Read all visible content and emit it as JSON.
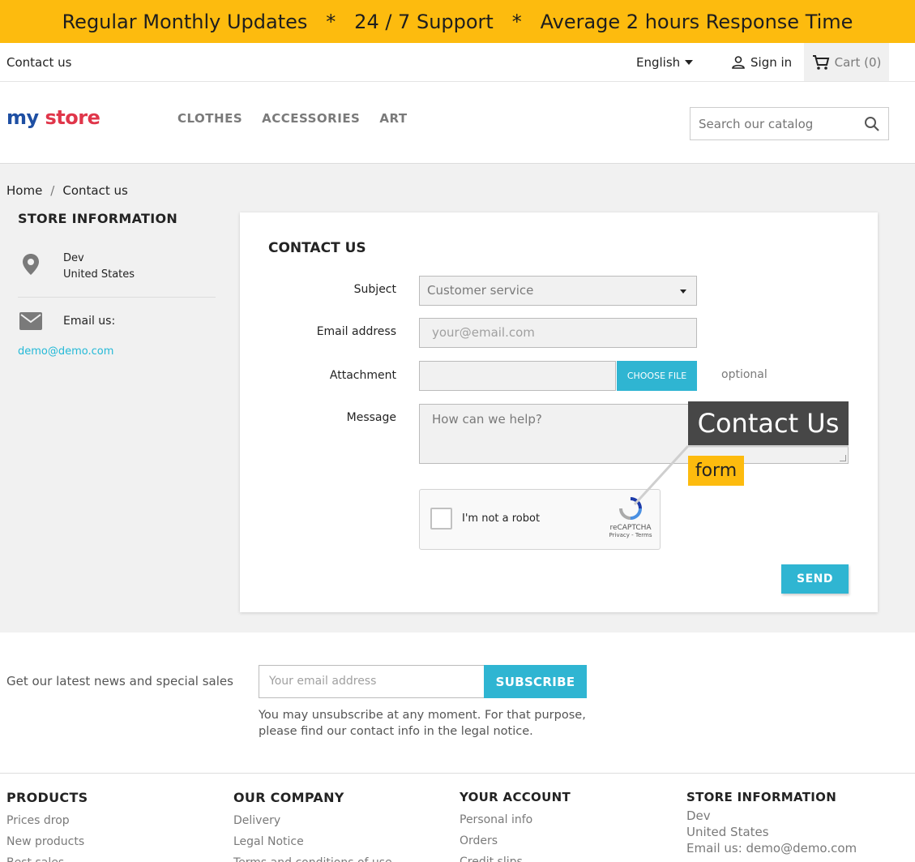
{
  "banner": {
    "text": "Regular Monthly Updates   *   24 / 7 Support   *   Average 2 hours Response Time"
  },
  "topnav": {
    "contact": "Contact us",
    "language": "English",
    "signin": "Sign in",
    "cart": "Cart (0)"
  },
  "header": {
    "logo": {
      "my": "my",
      "store": "store"
    },
    "menu": [
      "CLOTHES",
      "ACCESSORIES",
      "ART"
    ],
    "search_placeholder": "Search our catalog"
  },
  "breadcrumb": {
    "home": "Home",
    "sep": "/",
    "current": "Contact us"
  },
  "store_info": {
    "title": "STORE INFORMATION",
    "address_line1": "Dev",
    "address_line2": "United States",
    "email_label": "Email us:",
    "email": "demo@demo.com"
  },
  "contact_form": {
    "title": "CONTACT US",
    "subject_label": "Subject",
    "subject_value": "Customer service",
    "email_label": "Email address",
    "email_placeholder": "your@email.com",
    "attachment_label": "Attachment",
    "choose_file": "CHOOSE FILE",
    "optional": "optional",
    "message_label": "Message",
    "message_placeholder": "How can we help?",
    "recaptcha_text": "I'm not a robot",
    "recaptcha_brand": "reCAPTCHA",
    "recaptcha_terms": "Privacy - Terms",
    "send": "SEND"
  },
  "callout": {
    "title": "Contact Us",
    "subtitle": "form"
  },
  "newsletter": {
    "text": "Get our latest news and special sales",
    "placeholder": "Your email address",
    "button": "SUBSCRIBE",
    "note_line1": "You may unsubscribe at any moment. For that purpose,",
    "note_line2": "please find our contact info in the legal notice."
  },
  "footer": {
    "products": {
      "title": "PRODUCTS",
      "links": [
        "Prices drop",
        "New products",
        "Best sales"
      ]
    },
    "company": {
      "title": "OUR COMPANY",
      "links": [
        "Delivery",
        "Legal Notice",
        "Terms and conditions of use"
      ]
    },
    "account": {
      "title": "YOUR ACCOUNT",
      "links": [
        "Personal info",
        "Orders",
        "Credit slips"
      ]
    },
    "store": {
      "title": "STORE INFORMATION",
      "line1": "Dev",
      "line2": "United States",
      "line3": "Email us: demo@demo.com"
    }
  },
  "colors": {
    "banner": "#fdbb0e",
    "accent": "#2fb5d2",
    "callout_dark": "#474747"
  },
  "icons": [
    "caret-down-icon",
    "user-icon",
    "cart-icon",
    "search-icon",
    "map-pin-icon",
    "envelope-icon",
    "recaptcha-logo-icon"
  ]
}
